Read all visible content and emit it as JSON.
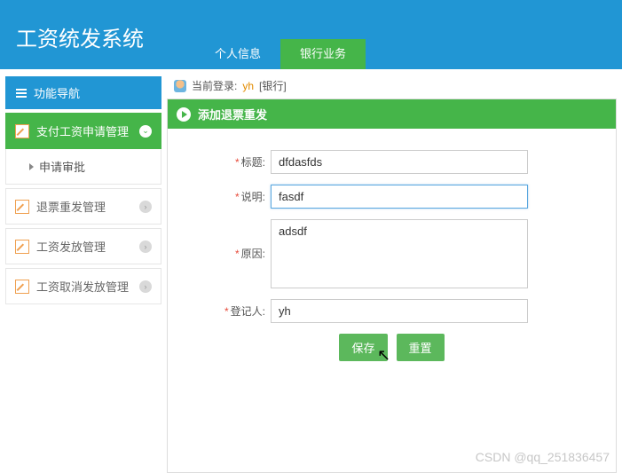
{
  "header": {
    "title": "工资统发系统",
    "tabs": [
      {
        "label": "个人信息",
        "active": false
      },
      {
        "label": "银行业务",
        "active": true
      }
    ]
  },
  "login": {
    "prefix": "当前登录:",
    "user": "yh",
    "role_suffix": "[银行]"
  },
  "sidebar": {
    "header": "功能导航",
    "items": [
      {
        "label": "支付工资申请管理",
        "active": true,
        "arrow": "⌄"
      },
      {
        "label": "退票重发管理",
        "active": false,
        "arrow": "›"
      },
      {
        "label": "工资发放管理",
        "active": false,
        "arrow": "›"
      },
      {
        "label": "工资取消发放管理",
        "active": false,
        "arrow": "›"
      }
    ],
    "sub_item": "申请审批"
  },
  "panel": {
    "title": "添加退票重发"
  },
  "form": {
    "title_label": "标题:",
    "title_value": "dfdasfds",
    "desc_label": "说明:",
    "desc_value": "fasdf",
    "reason_label": "原因:",
    "reason_value": "adsdf",
    "registrant_label": "登记人:",
    "registrant_value": "yh",
    "save_label": "保存",
    "reset_label": "重置"
  },
  "watermark": "CSDN @qq_251836457"
}
